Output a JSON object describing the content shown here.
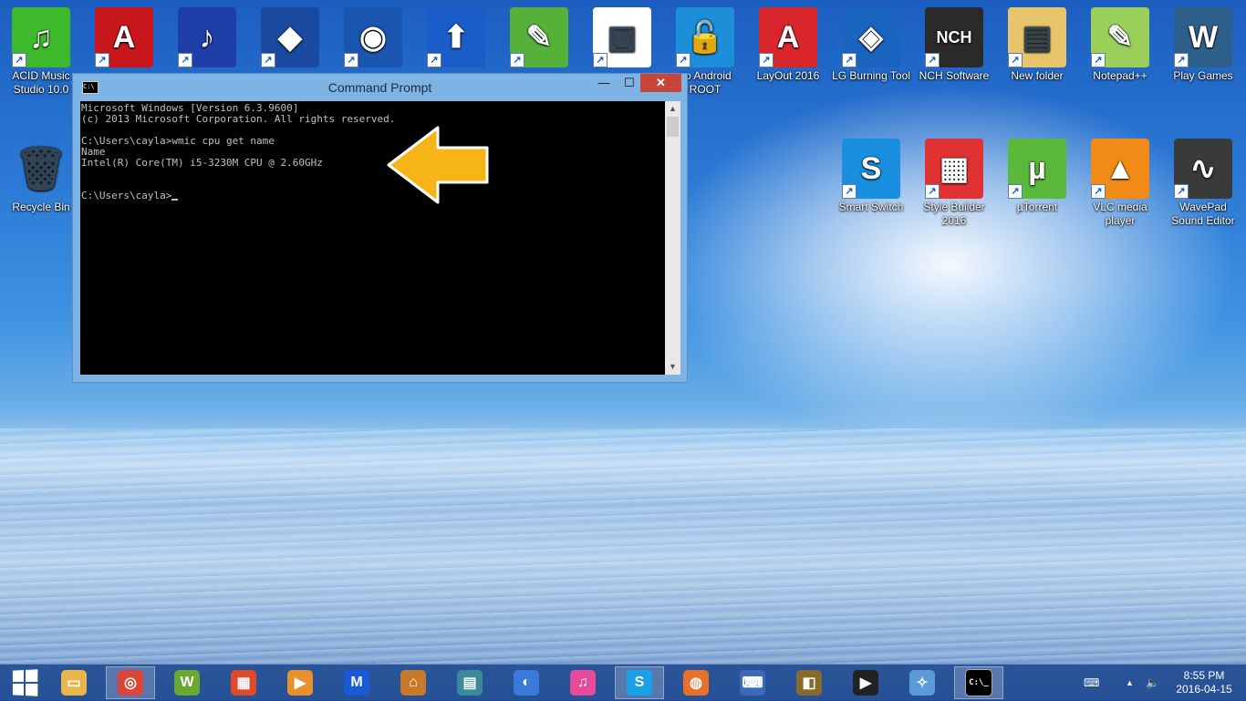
{
  "desktop": {
    "icons_top": [
      {
        "name": "acid-music-studio",
        "label": "ACID Music Studio 10.0",
        "glyph": "♫",
        "bg": "#3dba2c"
      },
      {
        "name": "adobe-reader",
        "label": "",
        "glyph": "A",
        "bg": "#c8161d"
      },
      {
        "name": "audacity",
        "label": "",
        "glyph": "♪",
        "bg": "#1f3fa8"
      },
      {
        "name": "app-4",
        "label": "",
        "glyph": "◆",
        "bg": "#1a4aa0"
      },
      {
        "name": "app-5",
        "label": "",
        "glyph": "◉",
        "bg": "#1a56b0"
      },
      {
        "name": "app-6",
        "label": "",
        "glyph": "⬆",
        "bg": "#1a5cc8"
      },
      {
        "name": "evernote",
        "label": "",
        "glyph": "✎",
        "bg": "#56b13a"
      },
      {
        "name": "intel-appup",
        "label": "",
        "glyph": "▣",
        "bg": "#ffffff"
      },
      {
        "name": "android-root",
        "label": "go Android ROOT",
        "glyph": "🔓",
        "bg": "#1c8fd8"
      },
      {
        "name": "layout-2016",
        "label": "LayOut 2016",
        "glyph": "A",
        "bg": "#d8262c"
      },
      {
        "name": "lg-burning-tool",
        "label": "LG Burning Tool",
        "glyph": "◈",
        "bg": "#1a64c0"
      },
      {
        "name": "nch-software",
        "label": "NCH Software",
        "glyph": "NCH",
        "bg": "#2a2a2a"
      },
      {
        "name": "new-folder",
        "label": "New folder",
        "glyph": "▤",
        "bg": "#e8c46a"
      },
      {
        "name": "notepad-plus-plus",
        "label": "Notepad++",
        "glyph": "✎",
        "bg": "#9ad05a"
      },
      {
        "name": "play-games",
        "label": "Play Games",
        "glyph": "W",
        "bg": "#2e5f8a"
      }
    ],
    "recycle_bin": {
      "label": "Recycle Bin",
      "glyph": "🗑"
    },
    "icons_second_row": [
      {
        "name": "smart-switch",
        "label": "Smart Switch",
        "glyph": "S",
        "bg": "#1a8fe0"
      },
      {
        "name": "style-builder-2016",
        "label": "Style Builder 2016",
        "glyph": "▦",
        "bg": "#e03232"
      },
      {
        "name": "utorrent",
        "label": "µTorrent",
        "glyph": "µ",
        "bg": "#5ab83a"
      },
      {
        "name": "vlc-media-player",
        "label": "VLC media player",
        "glyph": "▲",
        "bg": "#f28a18"
      },
      {
        "name": "wavepad-sound-editor",
        "label": "WavePad Sound Editor",
        "glyph": "∿",
        "bg": "#3a3a3a"
      }
    ],
    "shortcut_arrow": "↗"
  },
  "cmd": {
    "title": "Command Prompt",
    "icon_text": "C:\\",
    "buttons": {
      "minimize": "—",
      "maximize": "☐",
      "close": "✕"
    },
    "lines": {
      "l1": "Microsoft Windows [Version 6.3.9600]",
      "l2": "(c) 2013 Microsoft Corporation. All rights reserved.",
      "l3": "C:\\Users\\cayla>wmic cpu get name",
      "l4": "Name",
      "l5": "Intel(R) Core(TM) i5-3230M CPU @ 2.60GHz",
      "l6": "C:\\Users\\cayla>"
    },
    "scroll_up": "▲",
    "scroll_down": "▼"
  },
  "taskbar": {
    "apps": [
      {
        "name": "file-explorer",
        "glyph": "▭",
        "bg": "#e8b64a",
        "active": false
      },
      {
        "name": "chrome",
        "glyph": "◎",
        "bg": "#db4437",
        "active": true
      },
      {
        "name": "winzip",
        "glyph": "W",
        "bg": "#6aa832",
        "active": false
      },
      {
        "name": "ms-office",
        "glyph": "▦",
        "bg": "#e04a2a",
        "active": false
      },
      {
        "name": "media-app",
        "glyph": "▶",
        "bg": "#e8902a",
        "active": false
      },
      {
        "name": "malwarebytes",
        "glyph": "M",
        "bg": "#1a5ad8",
        "active": false
      },
      {
        "name": "app-bank",
        "glyph": "⌂",
        "bg": "#c87a2a",
        "active": false
      },
      {
        "name": "film-app",
        "glyph": "▤",
        "bg": "#3a8a9a",
        "active": false
      },
      {
        "name": "bird-app",
        "glyph": "◐",
        "bg": "#3a7ad8",
        "active": false
      },
      {
        "name": "itunes",
        "glyph": "♫",
        "bg": "#e84a9a",
        "active": false
      },
      {
        "name": "skype",
        "glyph": "S",
        "bg": "#1aa0e8",
        "active": true
      },
      {
        "name": "firefox",
        "glyph": "◍",
        "bg": "#e8702a",
        "active": false
      },
      {
        "name": "remote-app",
        "glyph": "⌨",
        "bg": "#3a6ab8",
        "active": false
      },
      {
        "name": "webcam-app",
        "glyph": "◧",
        "bg": "#8a6a2a",
        "active": false
      },
      {
        "name": "video-player",
        "glyph": "▶",
        "bg": "#222222",
        "active": false
      },
      {
        "name": "safari-app",
        "glyph": "✧",
        "bg": "#5a9ad8",
        "active": false
      },
      {
        "name": "command-prompt",
        "glyph": "C:\\_",
        "bg": "#000000",
        "active": true
      }
    ],
    "tray": {
      "keyboard": "⌨",
      "chevron": "▲",
      "volume": "🔈"
    },
    "time": "8:55 PM",
    "date": "2016-04-15"
  }
}
